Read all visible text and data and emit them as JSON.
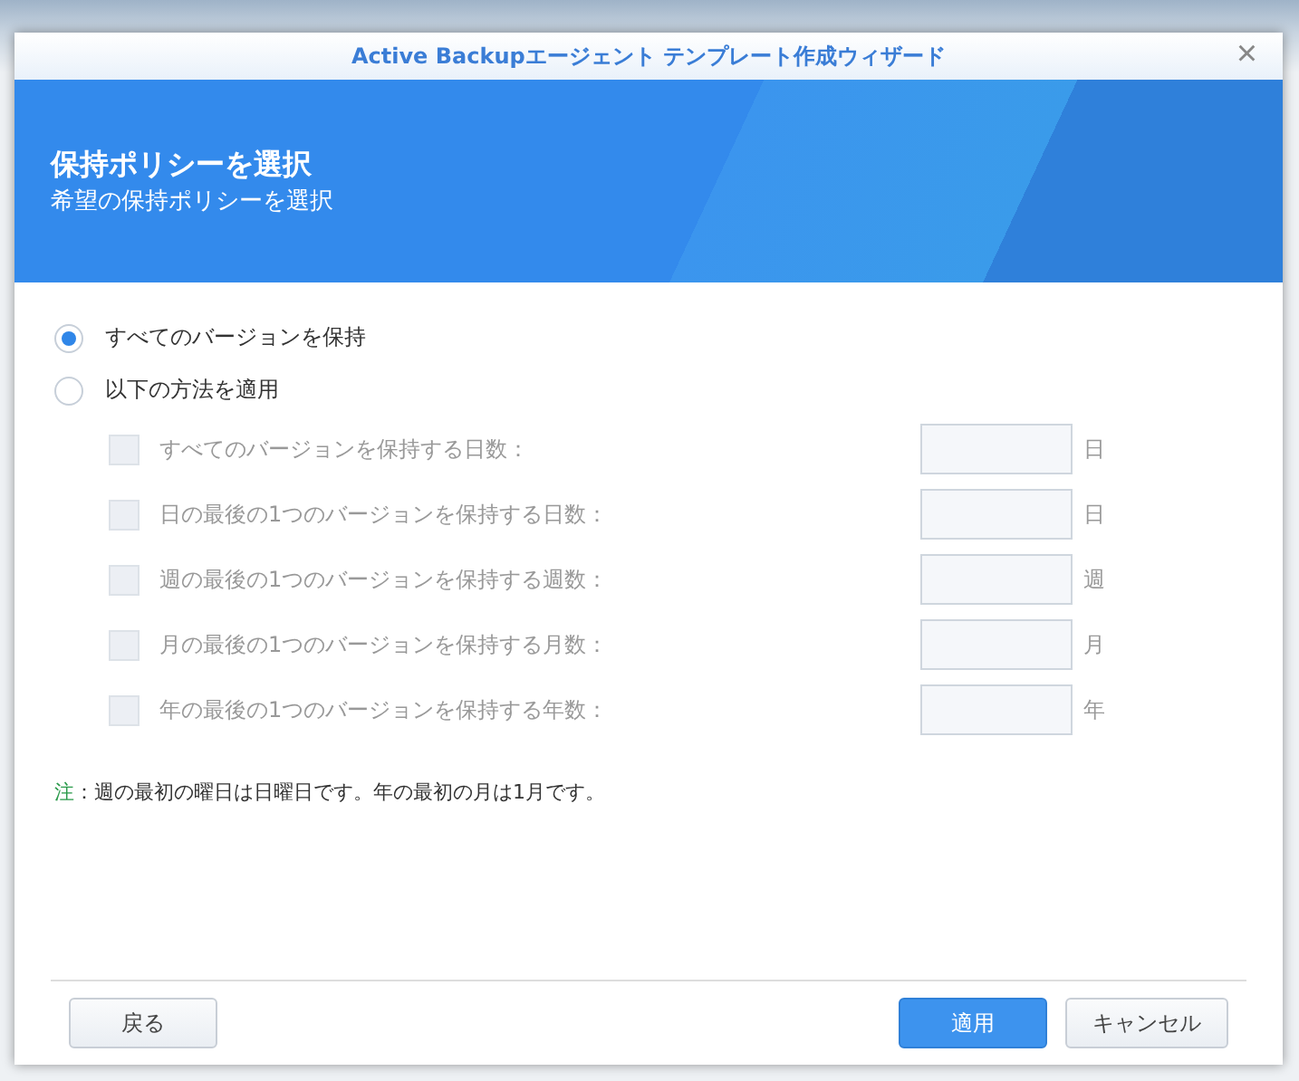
{
  "window": {
    "title": "Active Backupエージェント テンプレート作成ウィザード",
    "close": "×"
  },
  "header": {
    "title": "保持ポリシーを選択",
    "subtitle": "希望の保持ポリシーを選択"
  },
  "options": [
    {
      "label": "すべてのバージョンを保持",
      "selected": true
    },
    {
      "label": "以下の方法を適用",
      "selected": false
    }
  ],
  "rules": [
    {
      "label": "すべてのバージョンを保持する日数：",
      "unit": "日",
      "checked": false,
      "disabled": true
    },
    {
      "label": "日の最後の1つのバージョンを保持する日数：",
      "unit": "日",
      "checked": false,
      "disabled": true
    },
    {
      "label": "週の最後の1つのバージョンを保持する週数：",
      "unit": "週",
      "checked": false,
      "disabled": true
    },
    {
      "label": "月の最後の1つのバージョンを保持する月数：",
      "unit": "月",
      "checked": false,
      "disabled": true
    },
    {
      "label": "年の最後の1つのバージョンを保持する年数：",
      "unit": "年",
      "checked": false,
      "disabled": true
    }
  ],
  "note": {
    "label": "注",
    "text": "：週の最初の曜日は日曜日です。年の最初の月は1月です。"
  },
  "buttons": [
    {
      "label": "戻る",
      "kind": "secondary"
    },
    {
      "label": "適用",
      "kind": "primary"
    },
    {
      "label": "キャンセル",
      "kind": "secondary"
    }
  ]
}
